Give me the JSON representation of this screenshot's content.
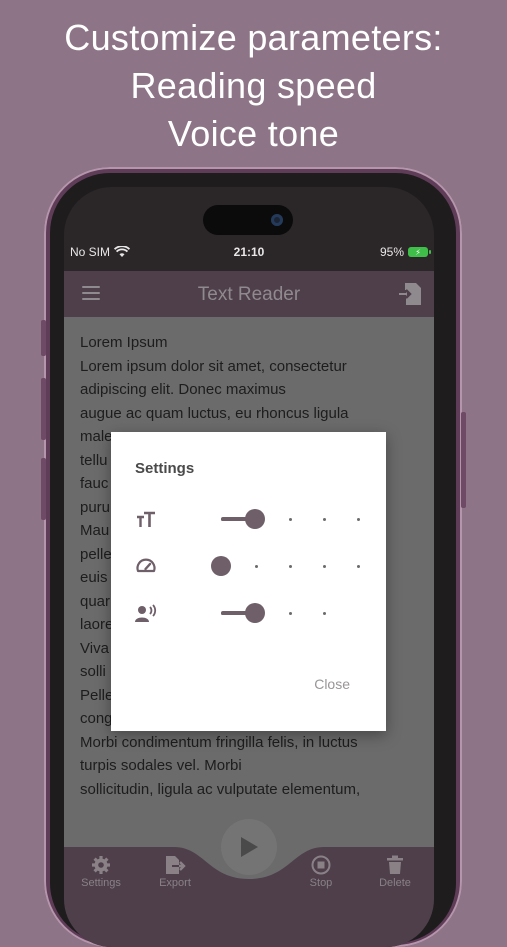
{
  "promo": {
    "line1": "Customize parameters:",
    "line2": "Reading speed",
    "line3": "Voice tone"
  },
  "status_bar": {
    "carrier": "No SIM",
    "time": "21:10",
    "battery_text": "95%"
  },
  "app_bar": {
    "title": "Text Reader",
    "menu_icon": "hamburger-menu-icon",
    "import_icon": "import-file-icon"
  },
  "document": {
    "lines": [
      "Lorem Ipsum",
      "Lorem ipsum dolor sit amet, consectetur",
      "adipiscing elit. Donec maximus",
      "augue ac quam luctus, eu rhoncus ligula",
      "male",
      "tellu",
      "fauc",
      "puru",
      "Mau",
      "pelle                                                 oin",
      "euis",
      "quar                                                 o",
      "laore",
      "Viva",
      "solli",
      "Pelle",
      "cong",
      "Morbi condimentum fringilla felis, in luctus",
      "turpis sodales vel. Morbi",
      "sollicitudin, ligula ac vulputate elementum,"
    ]
  },
  "settings_dialog": {
    "title": "Settings",
    "close_label": "Close",
    "sliders": [
      {
        "name": "text-size",
        "icon": "text-size-icon",
        "value_step": 1,
        "steps": 5
      },
      {
        "name": "reading-speed",
        "icon": "speedometer-icon",
        "value_step": 0,
        "steps": 5
      },
      {
        "name": "voice-tone",
        "icon": "voice-icon",
        "value_step": 1,
        "steps": 4
      }
    ]
  },
  "bottom_nav": {
    "settings": "Settings",
    "export": "Export",
    "stop": "Stop",
    "delete": "Delete",
    "play_icon": "play-icon"
  },
  "colors": {
    "background": "#8d7486",
    "app_bar": "#4e3f4a",
    "accent": "#6e5f69",
    "battery": "#3fbf4a"
  }
}
